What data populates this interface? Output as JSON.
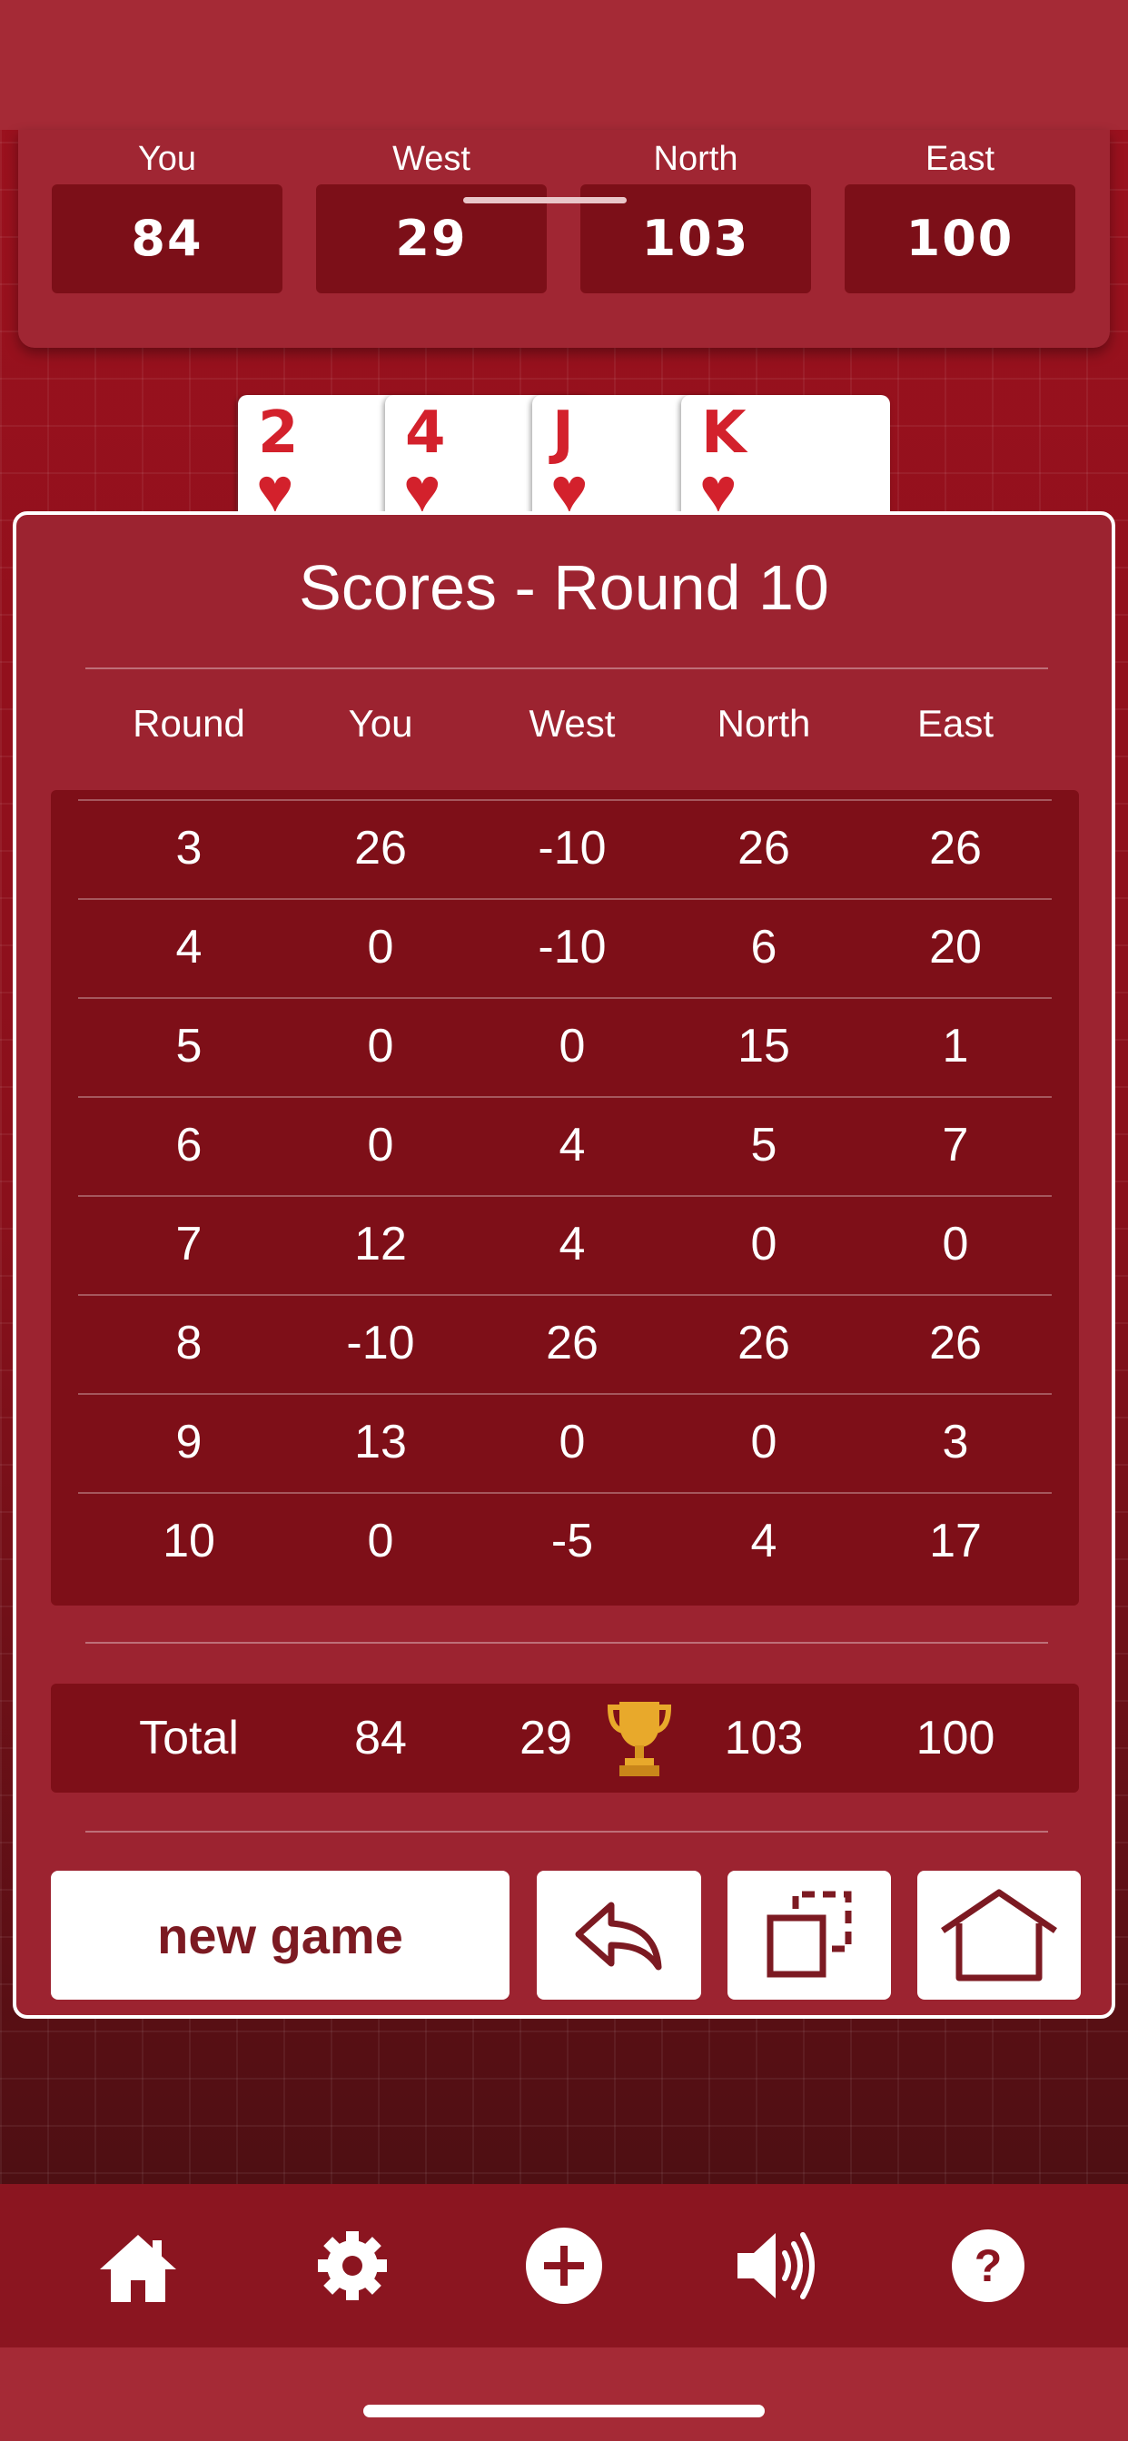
{
  "players": [
    {
      "name": "You",
      "score": "84"
    },
    {
      "name": "West",
      "score": "29"
    },
    {
      "name": "North",
      "score": "103"
    },
    {
      "name": "East",
      "score": "100"
    }
  ],
  "cards": [
    {
      "rank": "2",
      "suit": "♥"
    },
    {
      "rank": "4",
      "suit": "♥"
    },
    {
      "rank": "J",
      "suit": "♥"
    },
    {
      "rank": "K",
      "suit": "♥"
    }
  ],
  "modal": {
    "title": "Scores - Round 10",
    "headers": [
      "Round",
      "You",
      "West",
      "North",
      "East"
    ],
    "rows": [
      [
        "3",
        "26",
        "-10",
        "26",
        "26"
      ],
      [
        "4",
        "0",
        "-10",
        "6",
        "20"
      ],
      [
        "5",
        "0",
        "0",
        "15",
        "1"
      ],
      [
        "6",
        "0",
        "4",
        "5",
        "7"
      ],
      [
        "7",
        "12",
        "4",
        "0",
        "0"
      ],
      [
        "8",
        "-10",
        "26",
        "26",
        "26"
      ],
      [
        "9",
        "13",
        "0",
        "0",
        "3"
      ],
      [
        "10",
        "0",
        "-5",
        "4",
        "17"
      ]
    ],
    "total": [
      "Total",
      "84",
      "29",
      "103",
      "100"
    ],
    "new_game_label": "new game"
  },
  "icons": {
    "leader": "trophy-icon",
    "undo": "undo-arrow-icon",
    "copy": "copy-icon",
    "home_outline": "home-outline-icon",
    "nav": [
      "home-icon",
      "settings-gear-icon",
      "add-circle-icon",
      "sound-icon",
      "help-icon"
    ]
  },
  "colors": {
    "accent": "#a52a36",
    "felt": "#8e121c",
    "card_red": "#d3212c",
    "button_text": "#7c1a22"
  }
}
